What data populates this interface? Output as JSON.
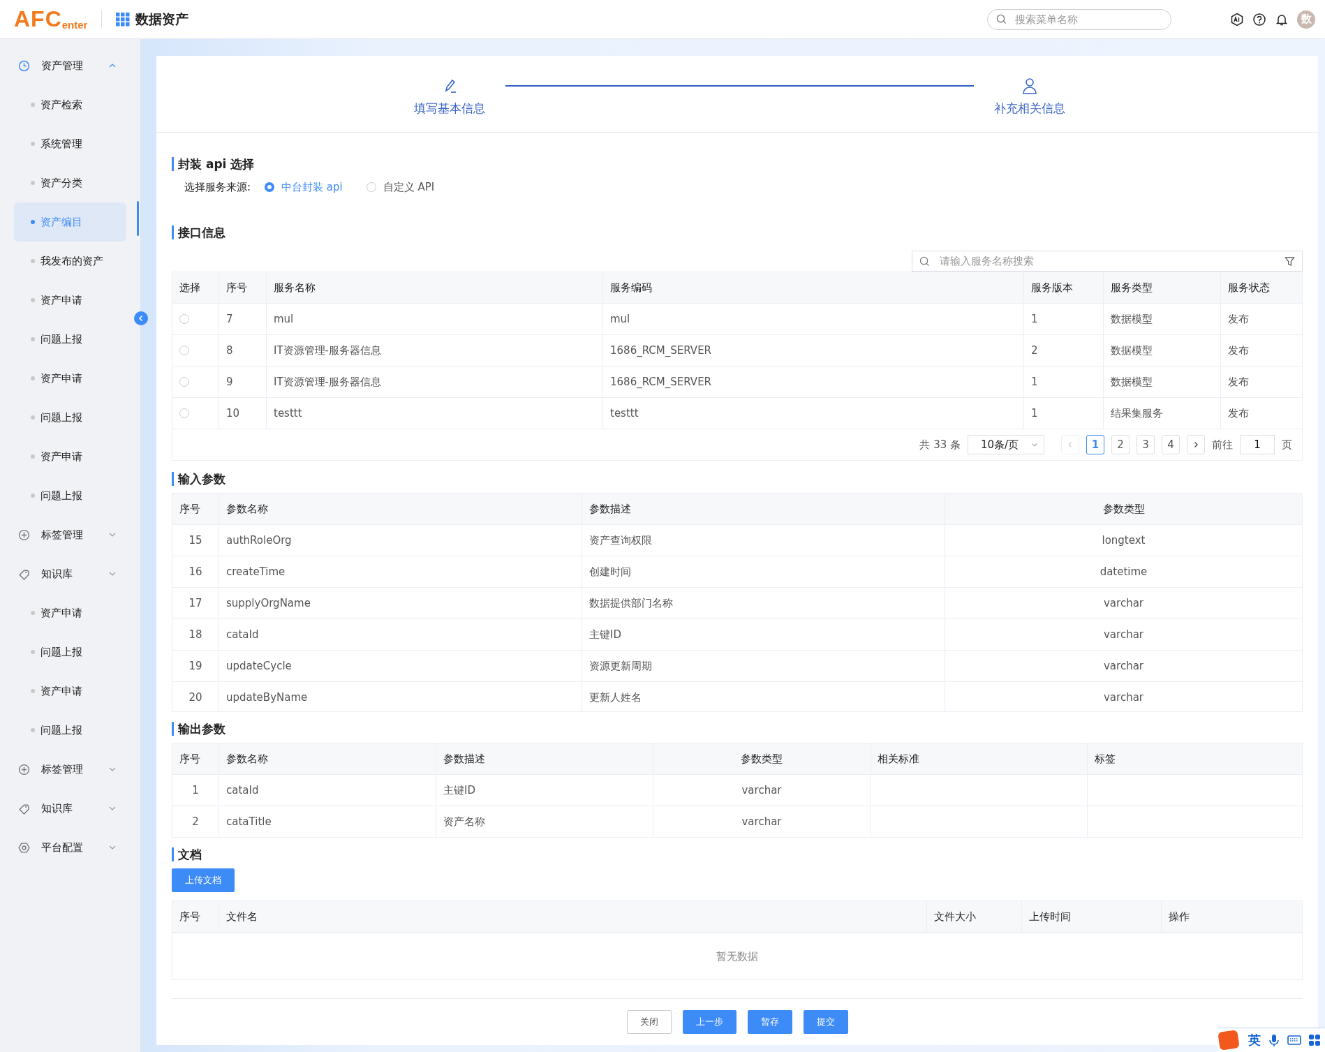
{
  "header": {
    "logo": "AFC",
    "logo_suffix": "enter",
    "title": "数据资产",
    "search": {
      "placeholder": "搜索菜单名称"
    },
    "avatar": "数"
  },
  "sidebar": {
    "items": [
      {
        "kind": "group",
        "label": "资产管理",
        "expanded": true
      },
      {
        "kind": "item",
        "label": "资产检索",
        "selected": false
      },
      {
        "kind": "item",
        "label": "系统管理",
        "selected": false
      },
      {
        "kind": "item",
        "label": "资产分类",
        "selected": false
      },
      {
        "kind": "item",
        "label": "资产编目",
        "selected": true
      },
      {
        "kind": "item",
        "label": "我发布的资产",
        "selected": false
      },
      {
        "kind": "item",
        "label": "资产申请",
        "selected": false
      },
      {
        "kind": "item",
        "label": "问题上报",
        "selected": false
      },
      {
        "kind": "item",
        "label": "资产申请",
        "selected": false
      },
      {
        "kind": "item",
        "label": "问题上报",
        "selected": false
      },
      {
        "kind": "item",
        "label": "资产申请",
        "selected": false
      },
      {
        "kind": "item",
        "label": "问题上报",
        "selected": false
      },
      {
        "kind": "group",
        "label": "标签管理",
        "expanded": false
      },
      {
        "kind": "group",
        "label": "知识库",
        "expanded": false
      },
      {
        "kind": "item",
        "label": "资产申请",
        "selected": false
      },
      {
        "kind": "item",
        "label": "问题上报",
        "selected": false
      },
      {
        "kind": "item",
        "label": "资产申请",
        "selected": false
      },
      {
        "kind": "item",
        "label": "问题上报",
        "selected": false
      },
      {
        "kind": "group",
        "label": "标签管理",
        "expanded": false
      },
      {
        "kind": "group",
        "label": "知识库",
        "expanded": false
      },
      {
        "kind": "group",
        "label": "平台配置",
        "expanded": false
      }
    ]
  },
  "steps": [
    {
      "label": "填写基本信息"
    },
    {
      "label": "补充相关信息"
    }
  ],
  "api_section": {
    "title": "封装 api 选择",
    "source_label": "选择服务来源:",
    "options": [
      {
        "label": "中台封装 api",
        "selected": true
      },
      {
        "label": "自定义 API",
        "selected": false
      }
    ]
  },
  "interface_section": {
    "title": "接口信息",
    "search": {
      "placeholder": "请输入服务名称搜索"
    },
    "columns": [
      "选择",
      "序号",
      "服务名称",
      "服务编码",
      "服务版本",
      "服务类型",
      "服务状态"
    ],
    "rows": [
      {
        "selected": false,
        "cells": [
          "",
          "7",
          "mul",
          "mul",
          "1",
          "数据模型",
          "发布"
        ]
      },
      {
        "selected": false,
        "cells": [
          "",
          "8",
          "IT资源管理-服务器信息",
          "1686_RCM_SERVER",
          "2",
          "数据模型",
          "发布"
        ]
      },
      {
        "selected": false,
        "cells": [
          "",
          "9",
          "IT资源管理-服务器信息",
          "1686_RCM_SERVER",
          "1",
          "数据模型",
          "发布"
        ]
      },
      {
        "selected": false,
        "cells": [
          "",
          "10",
          "testtt",
          "testtt",
          "1",
          "结果集服务",
          "发布"
        ]
      }
    ],
    "pagination": {
      "total": "共 33 条",
      "page_size": "10条/页",
      "pages": [
        {
          "label": "1",
          "selected": true
        },
        {
          "label": "2",
          "selected": false
        },
        {
          "label": "3",
          "selected": false
        },
        {
          "label": "4",
          "selected": false
        }
      ],
      "prev_disabled": true,
      "goto_label": "前往",
      "goto_value": "1",
      "page_suffix": "页"
    }
  },
  "input_section": {
    "title": "输入参数",
    "columns": [
      "序号",
      "参数名称",
      "参数描述",
      "参数类型"
    ],
    "rows": [
      [
        "15",
        "authRoleOrg",
        "资产查询权限",
        "longtext"
      ],
      [
        "16",
        "createTime",
        "创建时间",
        "datetime"
      ],
      [
        "17",
        "supplyOrgName",
        "数据提供部门名称",
        "varchar"
      ],
      [
        "18",
        "cataId",
        "主键ID",
        "varchar"
      ],
      [
        "19",
        "updateCycle",
        "资源更新周期",
        "varchar"
      ],
      [
        "20",
        "updateByName",
        "更新人姓名",
        "varchar"
      ]
    ]
  },
  "output_section": {
    "title": "输出参数",
    "columns": [
      "序号",
      "参数名称",
      "参数描述",
      "参数类型",
      "相关标准",
      "标签"
    ],
    "rows": [
      [
        "1",
        "cataId",
        "主键ID",
        "varchar",
        "",
        ""
      ],
      [
        "2",
        "cataTitle",
        "资产名称",
        "varchar",
        "",
        ""
      ]
    ]
  },
  "docs_section": {
    "title": "文档",
    "upload_button": "上传文档",
    "columns": [
      "序号",
      "文件名",
      "文件大小",
      "上传时间",
      "操作"
    ],
    "empty_text": "暂无数据"
  },
  "footer_buttons": [
    {
      "label": "关闭",
      "primary": false
    },
    {
      "label": "上一步",
      "primary": true
    },
    {
      "label": "暂存",
      "primary": true
    },
    {
      "label": "提交",
      "primary": true
    }
  ],
  "ime_toolbar": {
    "label": "英"
  }
}
